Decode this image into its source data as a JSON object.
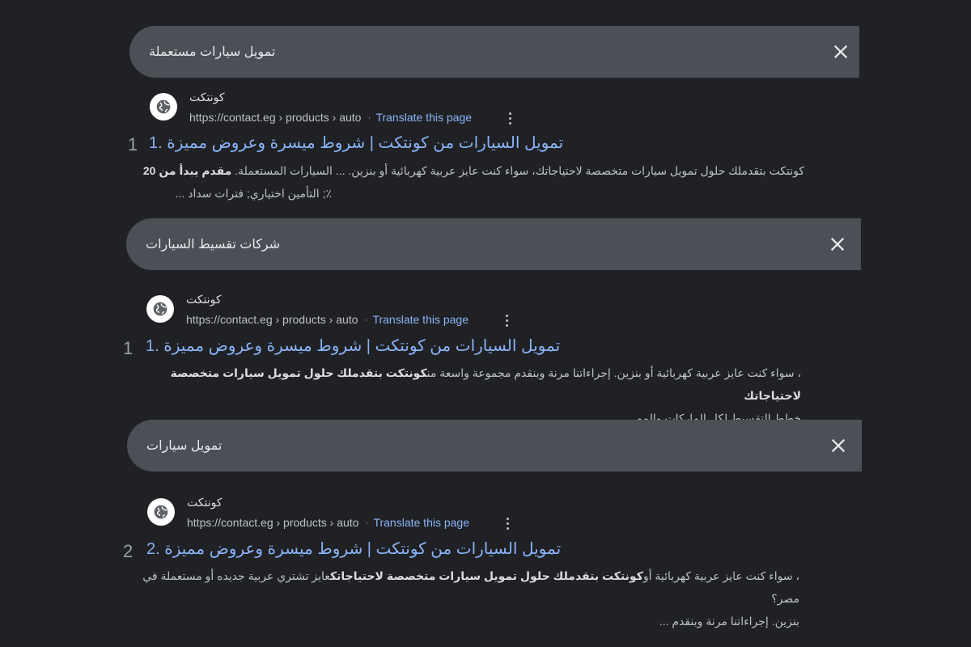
{
  "queries": [
    {
      "text": "تمويل سيارات مستعملة"
    },
    {
      "text": "شركات تقسيط السيارات"
    },
    {
      "text": "تمويل سيارات"
    }
  ],
  "results": [
    {
      "site_name": "كونتكت",
      "url": "https://contact.eg › products › auto",
      "translate_label": "Translate this page",
      "rank": "1",
      "title": "تمويل السيارات من كونتكت | شروط ميسرة وعروض مميزة .1",
      "snippet_line1": "كونتكت بتقدملك حلول تمويل سيارات متخصصة لاحتياجاتك، سواء كنت عايز عربية كهربائية أو بنزين. ... السيارات المستعملة. ",
      "snippet_line1_bold": "مقدم يبدأ من 20",
      "snippet_line2": "٪; التأمين اختياري; فترات سداد ..."
    },
    {
      "site_name": "كونتكت",
      "url": "https://contact.eg › products › auto",
      "translate_label": "Translate this page",
      "rank": "1",
      "title": "تمويل السيارات من كونتكت | شروط ميسرة وعروض مميزة .1",
      "snippet_line1_bold": "كونتكت بتقدملك حلول تمويل سيارات متخصصة لاحتياجاتك",
      "snippet_line1": "، سواء كنت عايز عربية كهربائية أو بنزين. إجراءاتنا مرنة وبنقدم مجموعة واسعة من",
      "snippet_line2": "خطط التقسيط لكل الماركات والمو ..."
    },
    {
      "site_name": "كونتكت",
      "url": "https://contact.eg › products › auto",
      "translate_label": "Translate this page",
      "rank": "2",
      "title": "تمويل السيارات من كونتكت | شروط ميسرة وعروض مميزة .2",
      "snippet_line1_pre": "عايز تشتري عربية جديده أو مستعملة في مصر؟ ",
      "snippet_line1_bold": "كونتكت بتقدملك حلول تمويل سيارات متخصصة لاحتياجاتك",
      "snippet_line1": "، سواء كنت عايز عربية كهربائية أو",
      "snippet_line2": "بنزين. إجراءاتنا مرنة وبنقدم ..."
    }
  ]
}
